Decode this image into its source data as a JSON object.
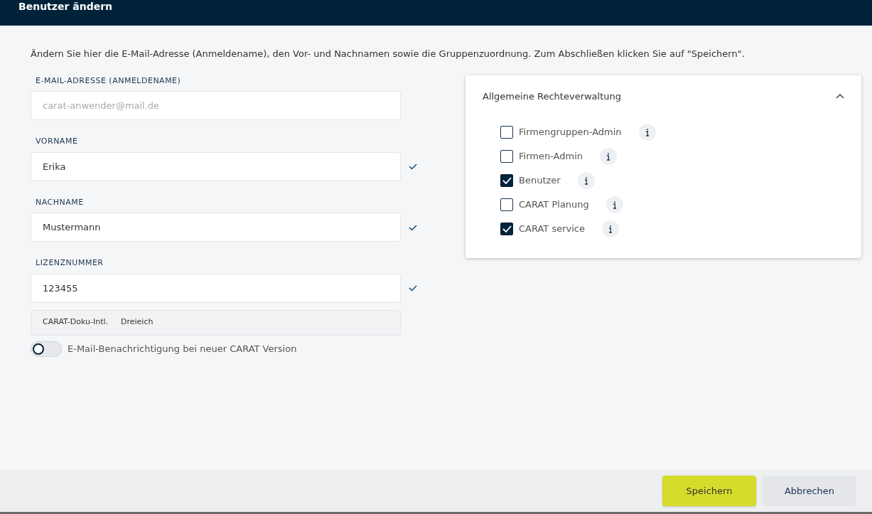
{
  "window": {
    "title": "Benutzer ändern"
  },
  "intro": "Ändern Sie hier die E-Mail-Adresse (Anmeldename), den Vor- und Nachnamen sowie die Gruppenzuordnung. Zum Abschließen klicken Sie auf \"Speichern\".",
  "fields": [
    {
      "label": "E-MAIL-ADRESSE (ANMELDENAME)",
      "placeholder": "carat-anwender@mail.de",
      "valid": false
    },
    {
      "label": "VORNAME",
      "value": "Erika",
      "valid": true
    },
    {
      "label": "NACHNAME",
      "value": "Mustermann",
      "valid": true
    },
    {
      "label": "LIZENZNUMMER",
      "value": "123455",
      "valid": true
    }
  ],
  "company": {
    "name": "CARAT-Doku-Intl.",
    "city": "Dreieich"
  },
  "notification": {
    "label": "E-Mail-Benachrichtigung bei neuer CARAT Version",
    "on": false
  },
  "rights": {
    "title": "Allgemeine Rechteverwaltung",
    "expanded": true,
    "items": [
      {
        "label": "Firmengruppen-Admin",
        "checked": false
      },
      {
        "label": "Firmen-Admin",
        "checked": false
      },
      {
        "label": "Benutzer",
        "checked": true
      },
      {
        "label": "CARAT Planung",
        "checked": false
      },
      {
        "label": "CARAT service",
        "checked": true
      }
    ]
  },
  "buttons": [
    {
      "label": "Speichern",
      "kind": "primary"
    },
    {
      "label": "Abbrechen",
      "kind": "secondary"
    }
  ]
}
